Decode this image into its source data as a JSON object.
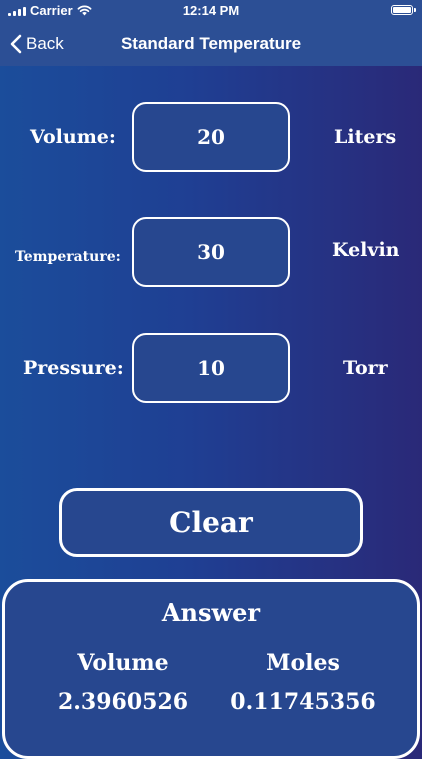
{
  "status_bar": {
    "carrier": "Carrier",
    "time": "12:14 PM"
  },
  "nav": {
    "back_label": "Back",
    "title": "Standard Temperature"
  },
  "form": {
    "volume": {
      "label": "Volume:",
      "value": "20",
      "unit": "Liters"
    },
    "temperature": {
      "label": "Temperature:",
      "value": "30",
      "unit": "Kelvin"
    },
    "pressure": {
      "label": "Pressure:",
      "value": "10",
      "unit": "Torr"
    }
  },
  "clear_label": "Clear",
  "answer": {
    "title": "Answer",
    "volume_label": "Volume",
    "volume_value": "2.3960526",
    "moles_label": "Moles",
    "moles_value": "0.11745356"
  },
  "colors": {
    "background_left": "#1b4d9b",
    "background_right": "#2a2978",
    "bar": "#2c4f95",
    "field": "#27478f",
    "text": "#ffffff"
  }
}
